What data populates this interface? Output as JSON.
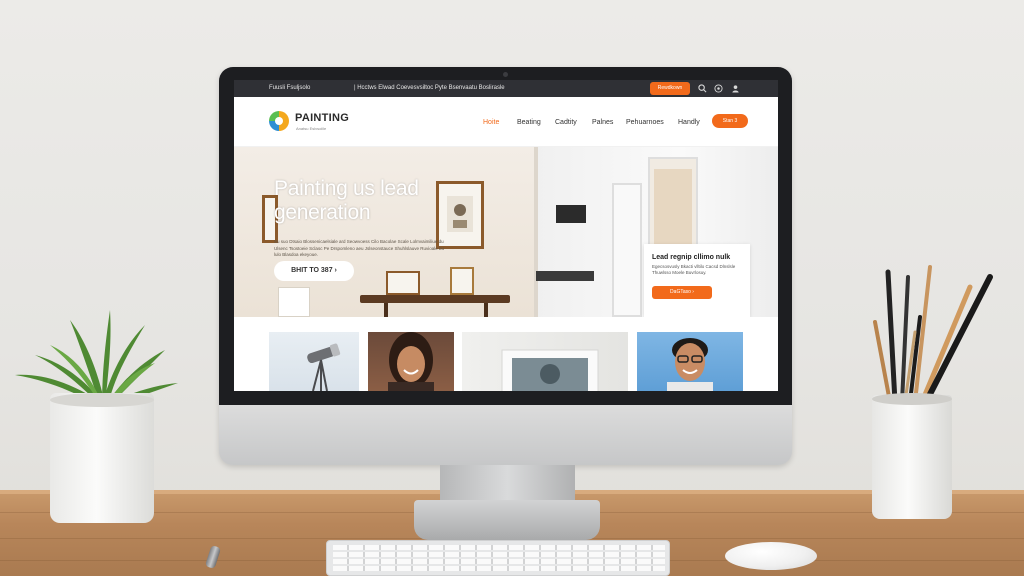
{
  "site": {
    "topbar": {
      "contact_left": "Fuusli Fsuljsolo",
      "links_text": "| Hcctws Elwad Coevesvsiltoc Pyte Bsenvaatu Boslirasle",
      "cta_label": "Rewdkown"
    },
    "brand": {
      "name": "PAINTING",
      "tagline": "Anatsu Eslvsoiile"
    },
    "nav": {
      "items": [
        {
          "label": "Hoite",
          "active": true
        },
        {
          "label": "Beating",
          "active": false
        },
        {
          "label": "Cadtity",
          "active": false
        },
        {
          "label": "Palnes",
          "active": false
        },
        {
          "label": "Pehuarnoes",
          "active": false
        },
        {
          "label": "Handly",
          "active": false
        }
      ],
      "cta_label": "Stan 3"
    },
    "hero": {
      "title": "Painting us lead generation",
      "description": "Su suo Dtsaio Blossenicaelsiale ard Seowvoess Cilo Bacolae Scale Lolmvaimiliue du Ulsenc Tsostoeie Sclasc Pe Drspomleno aeu Jslseonstauce Shuhlslauve Ruvioale bu lulo Blasdoa ekeyoue.",
      "cta_label": "BHIT TO 387"
    },
    "side_card": {
      "title": "Lead regnip cllimo nulk",
      "text": "Egecsosvusly Bkacti vlltilo Cacsd Dlnslsle Thuwlsso Moele Buvrlosuy.",
      "cta_label": "DaGTaso"
    }
  },
  "icons": {
    "search": "search-icon",
    "help": "help-icon",
    "user": "user-icon",
    "chevron": "chevron-right-icon"
  },
  "colors": {
    "accent": "#f26a1b",
    "topbar": "#2f3035",
    "bezel": "#1d1e21"
  }
}
